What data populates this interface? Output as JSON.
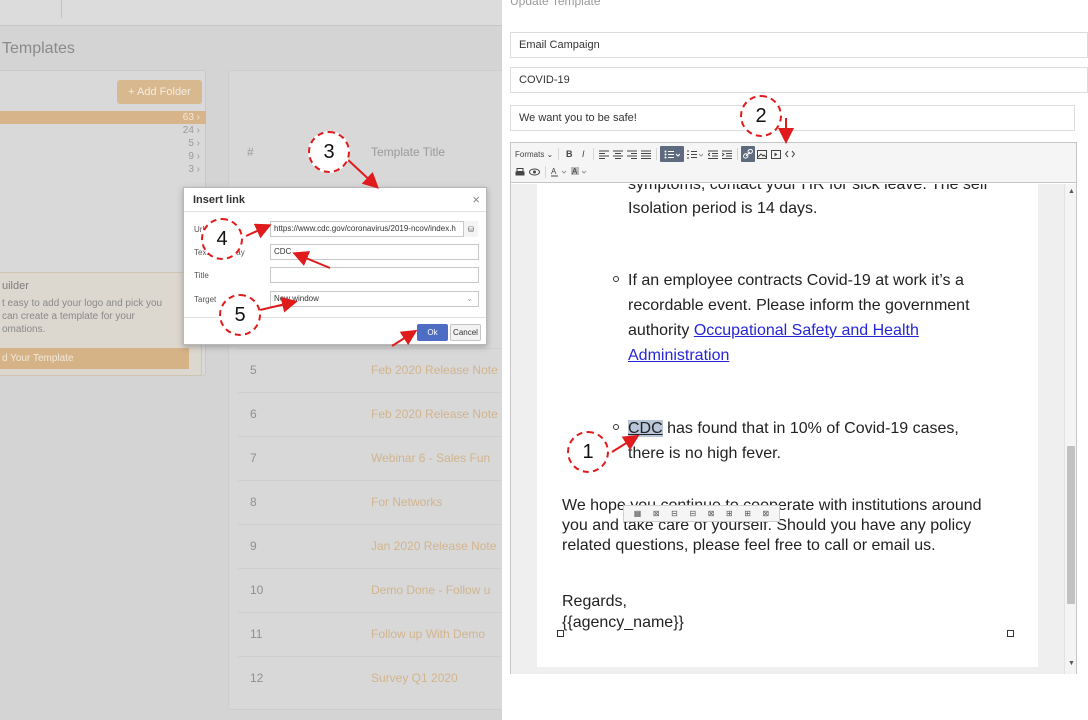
{
  "background": {
    "page_title": "Templates",
    "add_folder_label": "+ Add Folder",
    "folder_counts": [
      "63 ›",
      "24 ›",
      "5 ›",
      "9 ›",
      "3 ›"
    ],
    "builder": {
      "title": "uilder",
      "text": "t easy to add your logo and pick you can create a template for your omations.",
      "button_label": "d Your Template"
    },
    "table": {
      "col_num": "#",
      "col_title": "Template Title",
      "rows": [
        {
          "num": "5",
          "title": "Feb 2020 Release Note"
        },
        {
          "num": "6",
          "title": "Feb 2020 Release Note"
        },
        {
          "num": "7",
          "title": "Webinar 6 - Sales Fun"
        },
        {
          "num": "8",
          "title": "For Networks"
        },
        {
          "num": "9",
          "title": "Jan 2020 Release Note"
        },
        {
          "num": "10",
          "title": "Demo Done - Follow u"
        },
        {
          "num": "11",
          "title": "Follow up With Demo"
        },
        {
          "num": "12",
          "title": "Survey Q1 2020"
        }
      ]
    }
  },
  "dialog": {
    "title": "Insert link",
    "close": "×",
    "url_label": "Url",
    "url_value": "https://www.cdc.gov/coronavirus/2019-ncov/index.h",
    "url_button": "⛁",
    "text_label": "Text to display",
    "text_value": "CDC",
    "title_label": "Title",
    "title_value": "",
    "target_label": "Target",
    "target_value": "New window",
    "target_caret": "⌄",
    "ok_label": "Ok",
    "cancel_label": "Cancel"
  },
  "update_template": {
    "panel_title": "Update Template",
    "category": "Email Campaign",
    "name": "COVID-19",
    "subject": "We want you to be safe!",
    "toolbar": {
      "formats": "Formats ⌄",
      "bold": "B",
      "italic": "I"
    },
    "content": {
      "line_top_1": "symptoms, contact your HR for sick leave. The self",
      "line_top_2": "Isolation period is 14 days.",
      "bullet1_l1": "If an employee contracts Covid-19 at work it’s a",
      "bullet1_l2": "recordable event. Please inform the government",
      "bullet1_l3_a": "authority ",
      "bullet1_link1": "Occupational Safety and Health ",
      "bullet1_link2": "Administration",
      "bullet2_cdc": "CDC",
      "bullet2_l1": " has found that in 10% of Covid-19 cases,",
      "bullet2_l2": "there is no high fever.",
      "para_l1": "We hope you continue to cooperate with institutions around",
      "para_l2": "you and take care of yourself. Should you have any policy",
      "para_l3": "related questions, please feel free to call or email us.",
      "regards": "Regards,",
      "agency": "{{agency_name}}"
    }
  },
  "annotations": [
    "1",
    "2",
    "3",
    "4",
    "5"
  ],
  "colors": {
    "annotation_red": "#e01b1b",
    "ok_blue": "#4d6dc4",
    "link_blue": "#2626d6",
    "accent_tan": "#d7b48a"
  }
}
